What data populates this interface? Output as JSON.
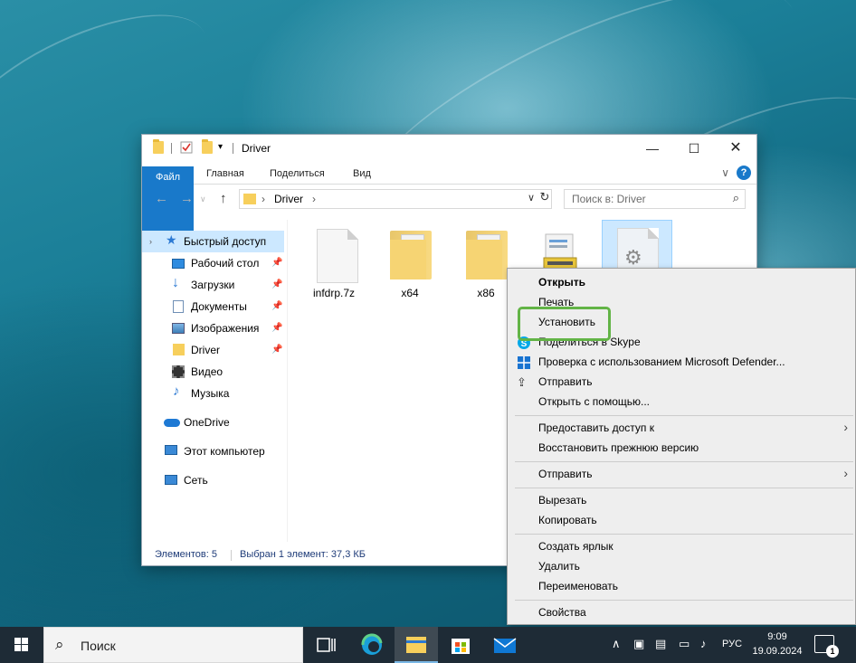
{
  "explorer": {
    "title": "Driver",
    "tabs": [
      "Файл",
      "Главная",
      "Поделиться",
      "Вид"
    ],
    "help_label": "?",
    "address_crumb": "Driver",
    "search_placeholder": "Поиск в: Driver",
    "nav": {
      "quick_access": "Быстрый доступ",
      "desktop": "Рабочий стол",
      "downloads": "Загрузки",
      "documents": "Документы",
      "pictures": "Изображения",
      "driver": "Driver",
      "video": "Видео",
      "music": "Музыка",
      "onedrive": "OneDrive",
      "this_pc": "Этот компьютер",
      "network": "Сеть"
    },
    "files": [
      {
        "name": "infdrp.7z",
        "type": "archive"
      },
      {
        "name": "x64",
        "type": "folder"
      },
      {
        "name": "x86",
        "type": "folder"
      },
      {
        "name": "",
        "type": "setup"
      },
      {
        "name": "",
        "type": "inf",
        "selected": true
      }
    ],
    "status_items": "Элементов: 5",
    "status_selected": "Выбран 1 элемент: 37,3 КБ"
  },
  "context_menu": {
    "open": "Открыть",
    "print": "Печать",
    "install": "Установить",
    "share_skype": "Поделиться в Skype",
    "defender": "Проверка с использованием Microsoft Defender...",
    "send": "Отправить",
    "open_with": "Открыть с помощью...",
    "give_access": "Предоставить доступ к",
    "restore": "Восстановить прежнюю версию",
    "send_to": "Отправить",
    "cut": "Вырезать",
    "copy": "Копировать",
    "create_shortcut": "Создать ярлык",
    "delete": "Удалить",
    "rename": "Переименовать",
    "properties": "Свойства",
    "highlight_color": "#62b446"
  },
  "taskbar": {
    "search_placeholder": "Поиск",
    "language": "РУС",
    "time": "9:09",
    "date": "19.09.2024",
    "notifications_count": "1"
  },
  "colors": {
    "accent": "#1979ca",
    "selection": "#cce8ff",
    "taskbar": "#1e2b36"
  }
}
